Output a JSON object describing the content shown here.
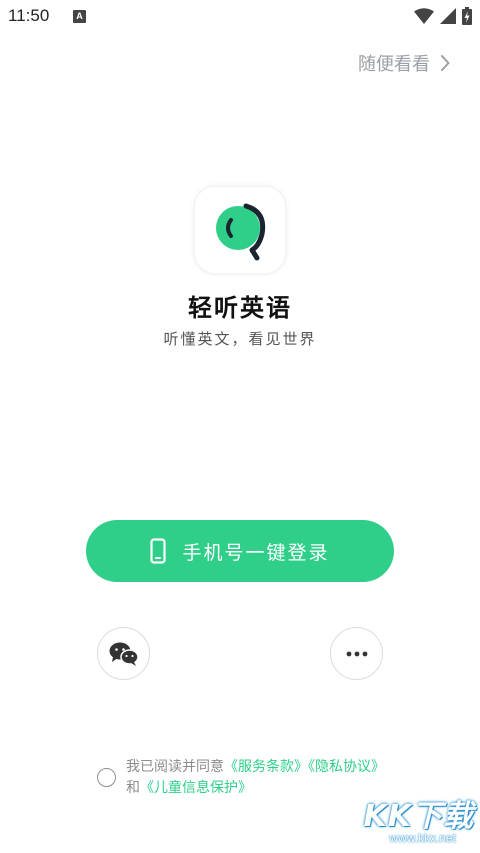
{
  "status_bar": {
    "time": "11:50",
    "notification_badge": "A"
  },
  "header": {
    "browse_label": "随便看看"
  },
  "brand": {
    "app_name": "轻听英语",
    "slogan": "听懂英文，看见世界",
    "accent_color": "#2fcf8a"
  },
  "login": {
    "one_tap_label": "手机号一键登录"
  },
  "alt_login": {
    "wechat_icon": "wechat-icon",
    "more_icon": "more-dots-icon"
  },
  "agreement": {
    "prefix": "我已阅读并同意",
    "terms_link": "《服务条款》",
    "privacy_link": "《隐私协议》",
    "and_text": "和",
    "children_link": "《儿童信息保护》"
  },
  "watermark": {
    "brand": "KK下载",
    "domain": "www.kkx.net"
  }
}
